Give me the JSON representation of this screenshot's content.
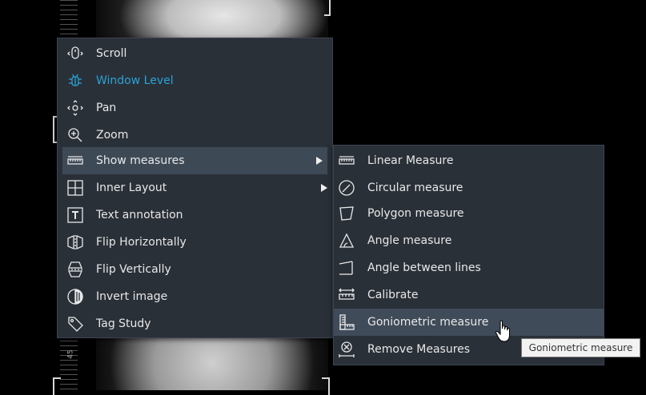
{
  "main_menu": {
    "items": [
      {
        "label": "Scroll",
        "icon": "mouse-scroll-icon"
      },
      {
        "label": "Window Level",
        "icon": "window-level-icon"
      },
      {
        "label": "Pan",
        "icon": "pan-icon"
      },
      {
        "label": "Zoom",
        "icon": "zoom-icon"
      },
      {
        "label": "Show measures",
        "icon": "ruler-icon"
      },
      {
        "label": "Inner Layout",
        "icon": "layout-grid-icon"
      },
      {
        "label": "Text annotation",
        "icon": "text-annotation-icon"
      },
      {
        "label": "Flip Horizontally",
        "icon": "flip-horizontal-icon"
      },
      {
        "label": "Flip Vertically",
        "icon": "flip-vertical-icon"
      },
      {
        "label": "Invert image",
        "icon": "invert-icon"
      },
      {
        "label": "Tag Study",
        "icon": "tag-icon"
      }
    ]
  },
  "sub_menu": {
    "items": [
      {
        "label": "Linear Measure",
        "icon": "linear-ruler-icon"
      },
      {
        "label": "Circular measure",
        "icon": "circle-measure-icon"
      },
      {
        "label": "Polygon measure",
        "icon": "polygon-icon"
      },
      {
        "label": "Angle measure",
        "icon": "angle-icon"
      },
      {
        "label": "Angle between lines",
        "icon": "angle-lines-icon"
      },
      {
        "label": "Calibrate",
        "icon": "calibrate-icon"
      },
      {
        "label": "Goniometric measure",
        "icon": "goniometric-icon"
      },
      {
        "label": "Remove Measures",
        "icon": "remove-measures-icon"
      }
    ]
  },
  "tooltip": {
    "text": "Goniometric measure"
  },
  "ruler_number": "45",
  "colors": {
    "menu_bg": "#2a3038",
    "highlight": "#3e4956",
    "active_text": "#29a3d6"
  }
}
